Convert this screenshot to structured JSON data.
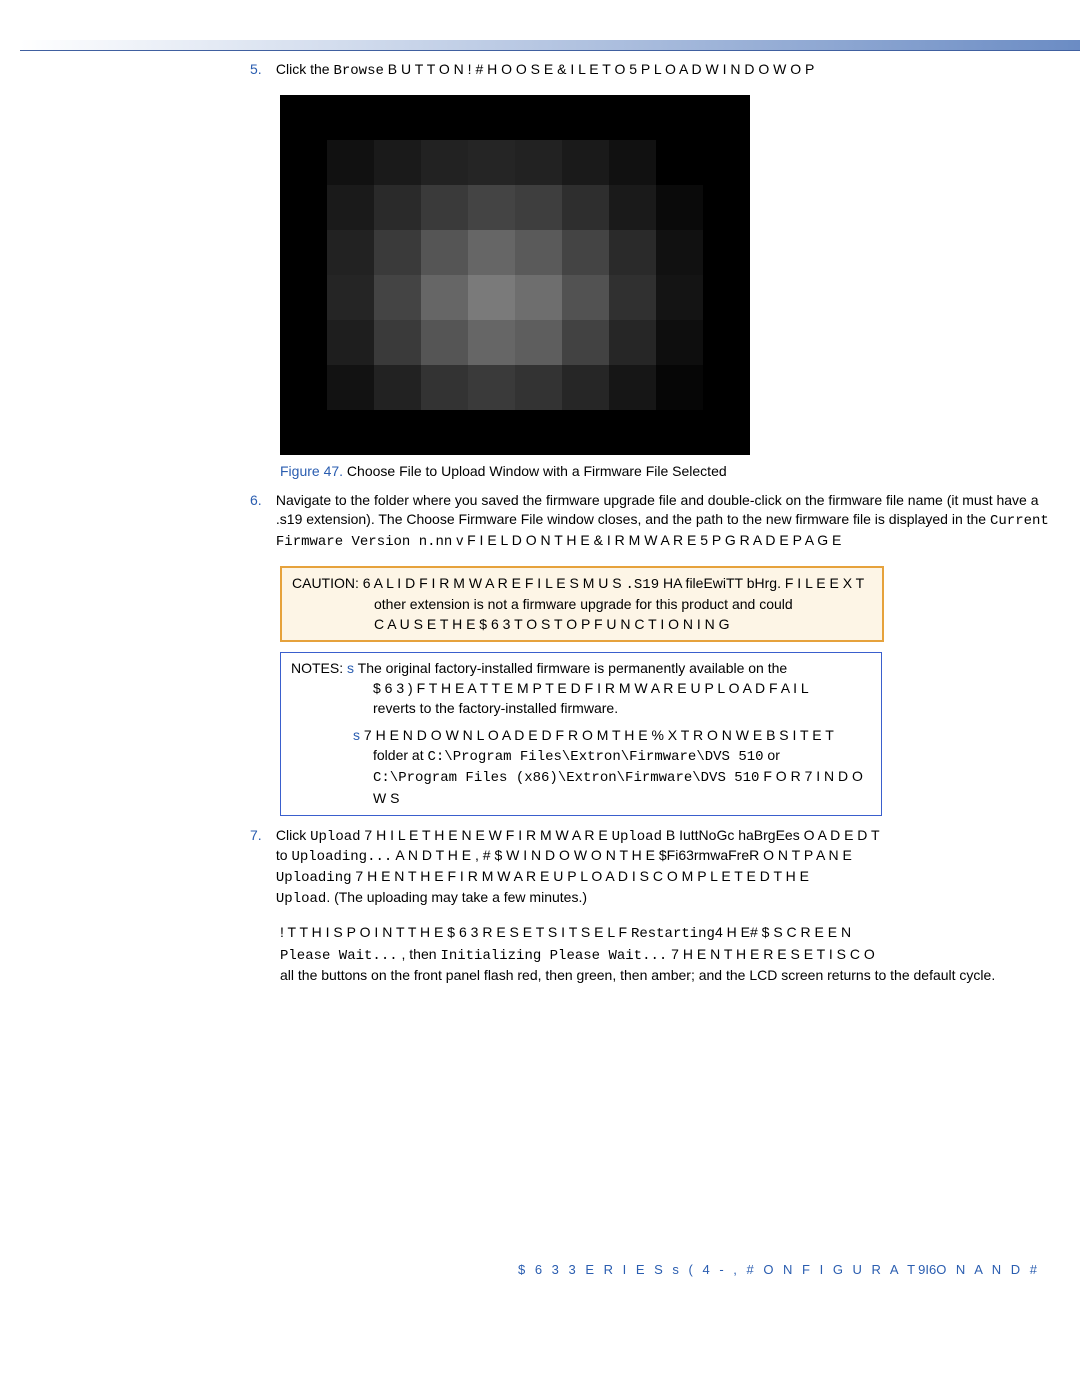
{
  "step5": {
    "num": "5.",
    "t1": "Click the ",
    "browse": "Browse",
    "t2": " B U T T O N   ! # H O O S E  & I L E  T O  5 P L O A D  W I N D O W  O P"
  },
  "figure": {
    "label": "Figure 47.",
    "caption": " Choose File to Upload Window with a Firmware File Selected"
  },
  "step6": {
    "num": "6.",
    "t1": "Navigate to the folder where you saved the firmware upgrade file and double-click on the firmware file name (it must have a .s19 extension). The Choose Firmware File window closes, and the path to the new firmware file is displayed in the ",
    "mono1": "Current Firmware Version n.nn",
    "t2": " v F I E L D  O N  T H E  & I R M W A R E  5 P G R A D E  P A G E"
  },
  "caution": {
    "label": "CAUTION:",
    "t1": "  6 A L I D  F I R M W A R E  F I L E S  M U S ",
    "mono1": ".S19",
    "t1b": "   HA fileEwiTT bHrg.   F I L E  E X T",
    "t2": "other extension is not a firmware upgrade for this product and could",
    "t3": "C A U S E  T H E  $ 6 3  T O  S T O P  F U N C T I O N I N G"
  },
  "notes": {
    "label": "NOTES:",
    "bullet": "s",
    "n1": "The original factory-installed firmware is permanently available on the",
    "n1b": "$ 6 3     ) F  T H E  A T T E M P T E D  F I R M W A R E  U P L O A D  F A I L",
    "n1c": "reverts to the factory-installed firmware.",
    "n2a": "7 H E N  D O W N L O A D E D  F R O M  T H E  % X T R O N  W E B S I T E   T",
    "n2b": "folder at ",
    "path1": "C:\\Program Files\\Extron\\Firmware\\DVS 510",
    "n2c": " or",
    "path2": "C:\\Program Files (x86)\\Extron\\Firmware\\DVS 510",
    "n2d": "  F O R  7 I N D O W S"
  },
  "step7": {
    "num": "7.",
    "t1": "Click ",
    "mono1": "Upload",
    "t2": "   7 H I L E  T H E  N E W  F I R M W A R E ",
    "mono2": "Upload",
    "t2b": " B IuttNoGc haBrgEes O A D E D   T",
    "t3": "to ",
    "mono3": "Uploading...",
    "t4": "   A N D  T H E  , # $  W I N D O W  O N  T H E  $Fi63rmwaFreR O N T  P A N E",
    "mono4": "Uploading",
    "t5": "   7 H E N  T H E  F I R M W A R E  U P L O A D  I S  C O M P L E T E D   T H E",
    "mono5": "Upload",
    "t6": ". (The uploading may take a few minutes.)"
  },
  "para8": {
    "t1": "! T  T H I S  P O I N T   T H E  $ 6 3  R E S E T S  I T S E L F  ",
    "mono1": "Restarting",
    "t1b": "4 H E# $  S C R E E N",
    "mono2": "Please Wait...",
    "t2": " , then ",
    "mono3": "Initializing  Please Wait...",
    "t3": "   7 H E N  T H E  R E S E T  I S  C O",
    "t4": "all the buttons on the front panel flash red, then green, then amber; and the LCD screen returns to the default cycle."
  },
  "footer": {
    "a": "$ 6 3   3 E R I E S s ( 4 - ,  # O N F I G U R A T",
    "pg": "9I6",
    "b": "O N  A N D  #"
  },
  "pixgrid": [
    [
      "#000",
      "#000",
      "#000",
      "#000",
      "#000",
      "#000",
      "#000",
      "#000",
      "#000",
      "#000"
    ],
    [
      "#000",
      "#111",
      "#1a1a1a",
      "#222",
      "#252525",
      "#222",
      "#1a1a1a",
      "#111",
      "#000",
      "#000"
    ],
    [
      "#000",
      "#1a1a1a",
      "#2a2a2a",
      "#3a3a3a",
      "#444",
      "#3e3e3e",
      "#2e2e2e",
      "#1a1a1a",
      "#0a0a0a",
      "#000"
    ],
    [
      "#000",
      "#222",
      "#3a3a3a",
      "#555",
      "#666",
      "#5a5a5a",
      "#444",
      "#2a2a2a",
      "#111",
      "#000"
    ],
    [
      "#000",
      "#252525",
      "#444",
      "#666",
      "#7a7a7a",
      "#6e6e6e",
      "#525252",
      "#303030",
      "#141414",
      "#000"
    ],
    [
      "#000",
      "#1e1e1e",
      "#3a3a3a",
      "#555",
      "#666",
      "#5e5e5e",
      "#424242",
      "#262626",
      "#0e0e0e",
      "#000"
    ],
    [
      "#000",
      "#121212",
      "#222",
      "#333",
      "#3a3a3a",
      "#333",
      "#262626",
      "#161616",
      "#060606",
      "#000"
    ],
    [
      "#000",
      "#000",
      "#000",
      "#000",
      "#000",
      "#000",
      "#000",
      "#000",
      "#000",
      "#000"
    ]
  ]
}
